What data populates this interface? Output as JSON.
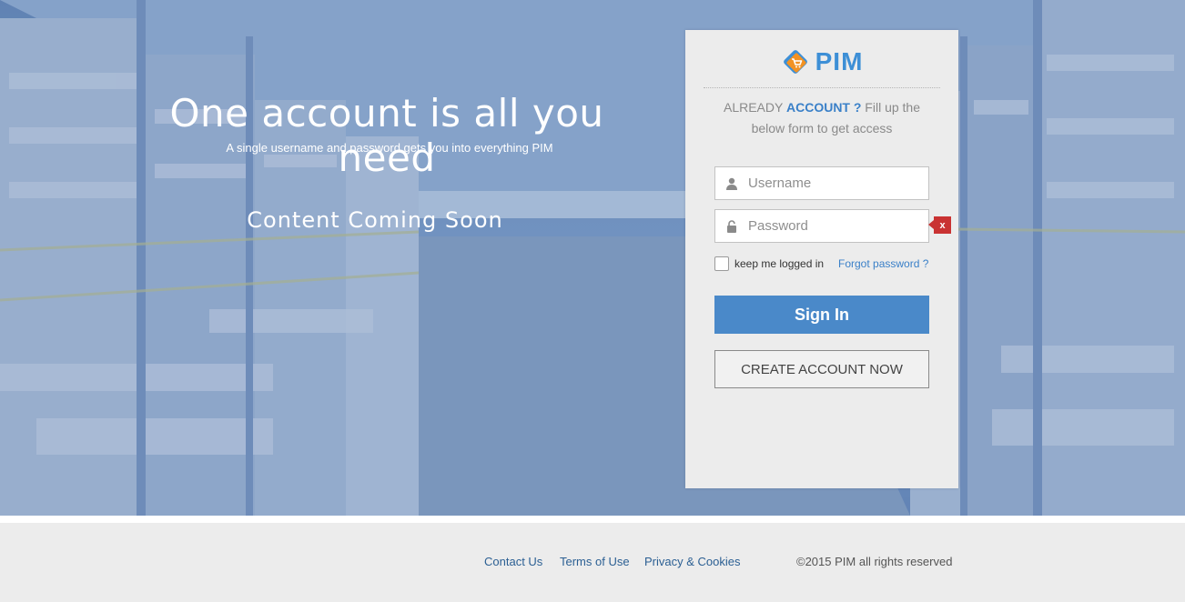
{
  "hero": {
    "headline": "One account is all you need",
    "subline": "A single username and password gets you into everything PIM",
    "coming_soon": "Content Coming Soon"
  },
  "login": {
    "logo_text": "PIM",
    "tagline_pre": "ALREADY ",
    "tagline_strong": "ACCOUNT ?",
    "tagline_post": " Fill up the below form to get access",
    "username_placeholder": "Username",
    "password_placeholder": "Password",
    "error_badge": "x",
    "remember_label": "keep me logged in",
    "forgot_label": "Forgot password ?",
    "signin_label": "Sign In",
    "create_label": "CREATE ACCOUNT NOW"
  },
  "footer": {
    "links": [
      "Contact Us",
      "Terms of Use",
      "Privacy & Cookies"
    ],
    "copyright": "©2015 PIM all rights reserved"
  },
  "colors": {
    "accent": "#4a89c9",
    "link": "#3a80c8",
    "error": "#c93232",
    "logo_orange": "#f29223"
  },
  "icons": [
    "pim-logo-icon",
    "user-icon",
    "lock-icon"
  ]
}
